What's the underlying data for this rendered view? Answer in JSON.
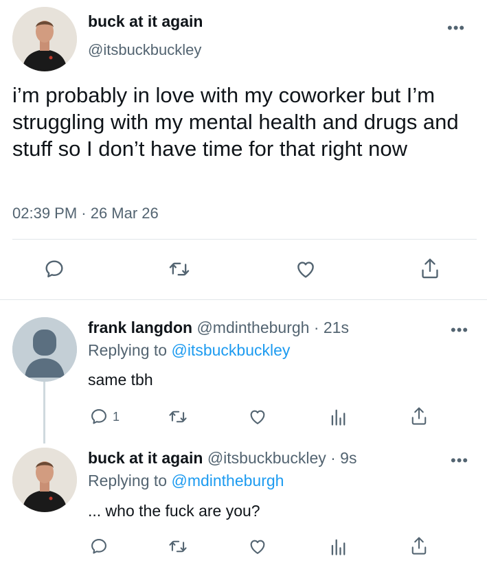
{
  "main_tweet": {
    "name": "buck at it again",
    "handle": "@itsbuckbuckley",
    "more": "•••",
    "text": "i’m probably in love with my coworker but I’m struggling with my mental health and drugs and stuff so I don’t have time for that right now",
    "timestamp": "02:39 PM · 26 Mar 26",
    "actions": [
      "reply-icon",
      "retweet-icon",
      "like-icon",
      "share-icon"
    ]
  },
  "replies": [
    {
      "name": "frank langdon",
      "meta": " @mdintheburgh · 21s",
      "replying_prefix": "Replying to ",
      "replying_mention": "@itsbuckbuckley",
      "text": "same tbh",
      "reply_count": "1",
      "more": "•••"
    },
    {
      "name": "buck at it again",
      "meta": " @itsbuckbuckley · 9s",
      "replying_prefix": "Replying to ",
      "replying_mention": "@mdintheburgh",
      "text": "... who the fuck are you?",
      "reply_count": "",
      "more": "•••"
    }
  ],
  "colors": {
    "text": "#0f1419",
    "secondary": "#536471",
    "link": "#1d9bf0",
    "divider": "#e1e6ea"
  }
}
